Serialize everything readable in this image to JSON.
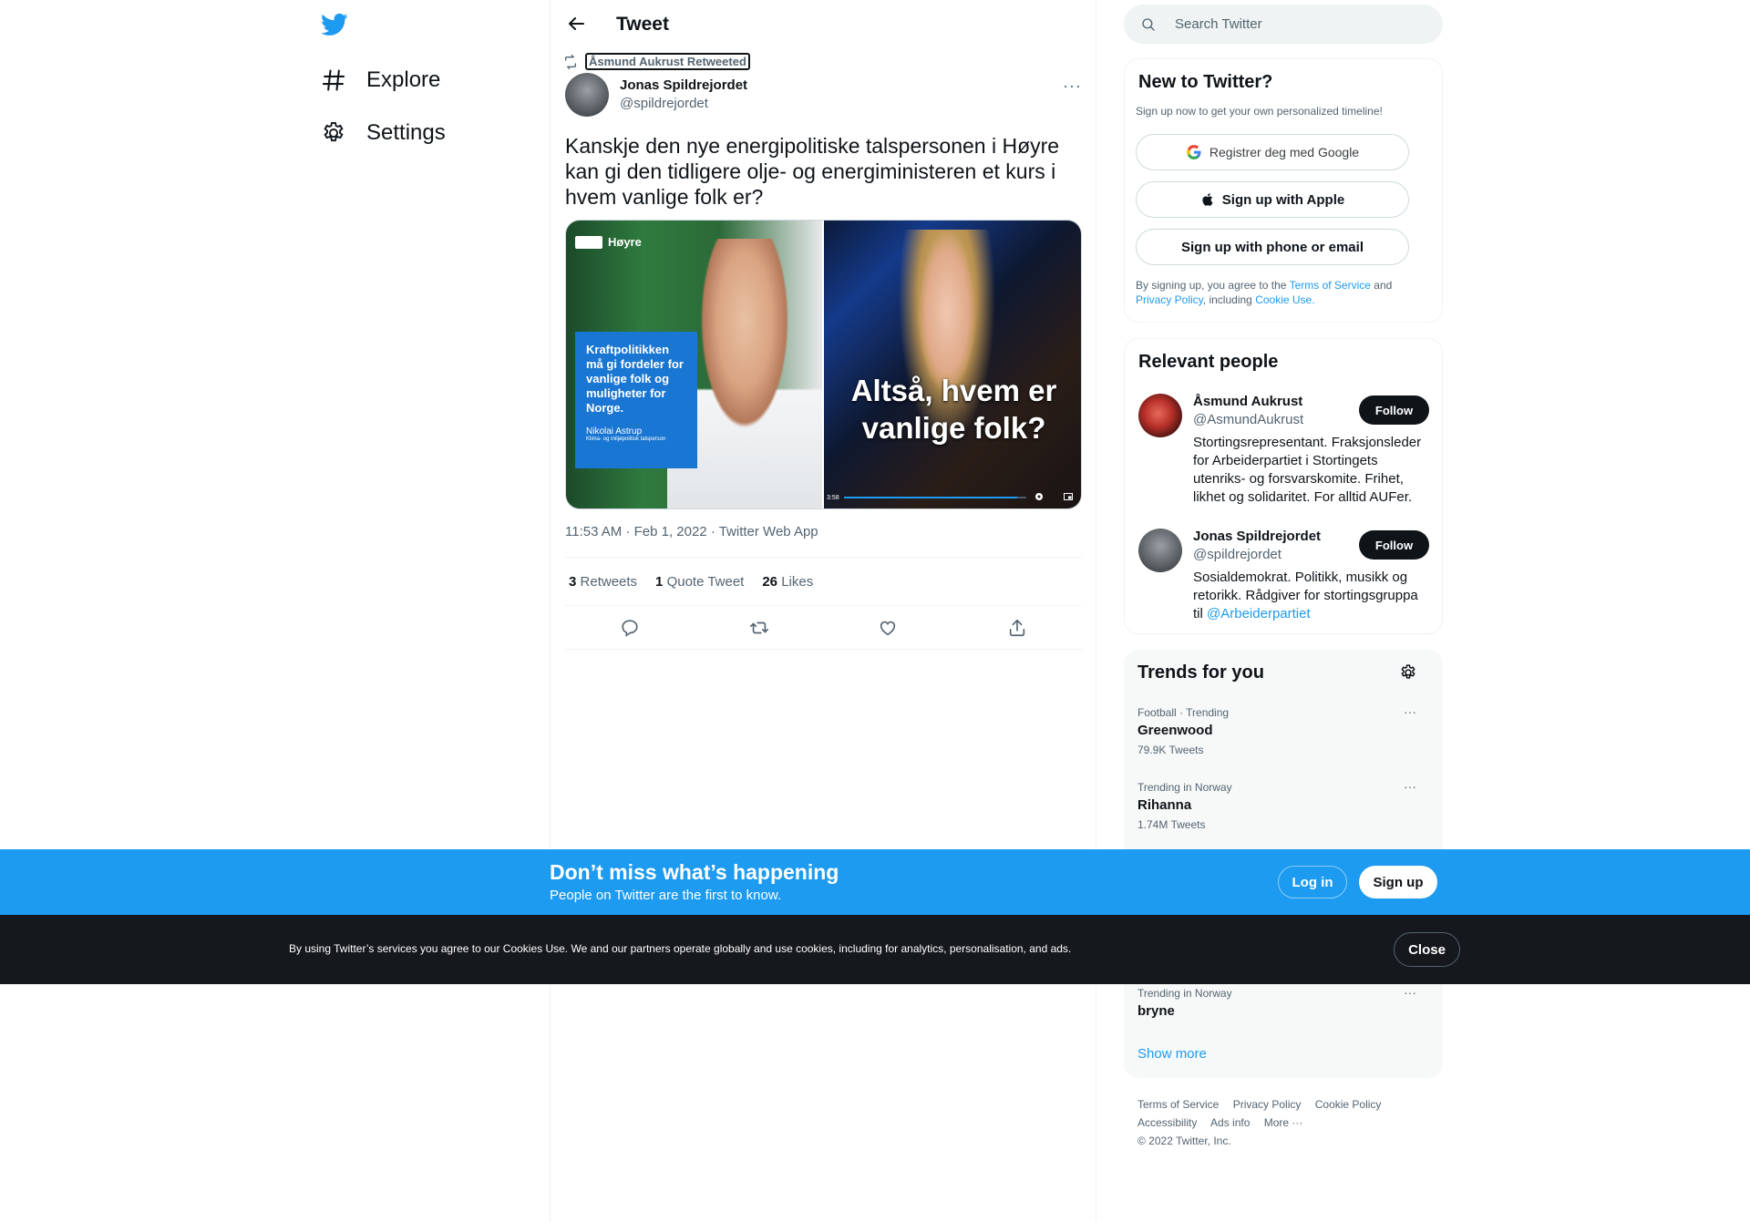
{
  "nav": {
    "explore_label": "Explore",
    "settings_label": "Settings"
  },
  "header": {
    "title": "Tweet"
  },
  "tweet": {
    "retweeted_by": "Åsmund Aukrust Retweeted",
    "author_name": "Jonas Spildrejordet",
    "author_handle": "@spildrejordet",
    "text": "Kanskje den nye energipolitiske talspersonen i Høyre kan gi den tidligere olje- og energiministeren et kurs i hvem vanlige folk er?",
    "media": {
      "left_brand": "Høyre",
      "left_quote": "Kraftpolitikken må gi fordeler for vanlige folk og muligheter for Norge.",
      "left_name": "Nikolai Astrup",
      "left_role": "Klima- og miljøpolitisk talsperson",
      "right_caption": "Altså, hvem er vanlige folk?",
      "video_time": "3:58",
      "video_progress": 0.95
    },
    "timestamp": "11:53 AM · Feb 1, 2022 · Twitter Web App",
    "stats": {
      "retweets_count": "3",
      "retweets_label": "Retweets",
      "quotes_count": "1",
      "quotes_label": "Quote Tweet",
      "likes_count": "26",
      "likes_label": "Likes"
    }
  },
  "search": {
    "placeholder": "Search Twitter"
  },
  "new_to_twitter": {
    "title": "New to Twitter?",
    "subtitle": "Sign up now to get your own personalized timeline!",
    "google_label": "Registrer deg med Google",
    "apple_label": "Sign up with Apple",
    "phone_label": "Sign up with phone or email",
    "legal_prefix": "By signing up, you agree to the",
    "terms_link": "Terms of Service",
    "legal_and": "and",
    "privacy_link": "Privacy Policy",
    "legal_including": ", including",
    "cookie_link": "Cookie Use."
  },
  "relevant_people": {
    "title": "Relevant people",
    "people": [
      {
        "name": "Åsmund Aukrust",
        "handle": "@AsmundAukrust",
        "bio": "Stortingsrepresentant. Fraksjonsleder for Arbeiderpartiet i Stortingets utenriks- og forsvarskomite. Frihet, likhet og solidaritet. For alltid AUFer.",
        "follow_label": "Follow"
      },
      {
        "name": "Jonas Spildrejordet",
        "handle": "@spildrejordet",
        "bio": "Sosialdemokrat. Politikk, musikk og retorikk. Rådgiver for stortingsgruppa til",
        "bio_link": "@Arbeiderpartiet",
        "follow_label": "Follow"
      }
    ]
  },
  "trends": {
    "title": "Trends for you",
    "items": [
      {
        "context": "Football · Trending",
        "name": "Greenwood",
        "count": "79.9K Tweets"
      },
      {
        "context": "Trending in Norway",
        "name": "Rihanna",
        "count": "1.74M Tweets"
      },
      {
        "context": "Trending in Norway",
        "name": "bryne",
        "count": ""
      }
    ],
    "show_more": "Show more"
  },
  "footer": {
    "links": [
      "Terms of Service",
      "Privacy Policy",
      "Cookie Policy",
      "Accessibility",
      "Ads info",
      "More ···"
    ],
    "copyright": "© 2022 Twitter, Inc."
  },
  "bottom_bar": {
    "title": "Don’t miss what’s happening",
    "subtitle": "People on Twitter are the first to know.",
    "login_label": "Log in",
    "signup_label": "Sign up"
  },
  "cookie_bar": {
    "text": "By using Twitter’s services you agree to our Cookies Use. We and our partners operate globally and use cookies, including for analytics, personalisation, and ads.",
    "close_label": "Close"
  },
  "colors": {
    "accent": "#1d9bf0",
    "text": "#0f1419",
    "muted": "#536471",
    "cookie_bg": "#15181c"
  }
}
